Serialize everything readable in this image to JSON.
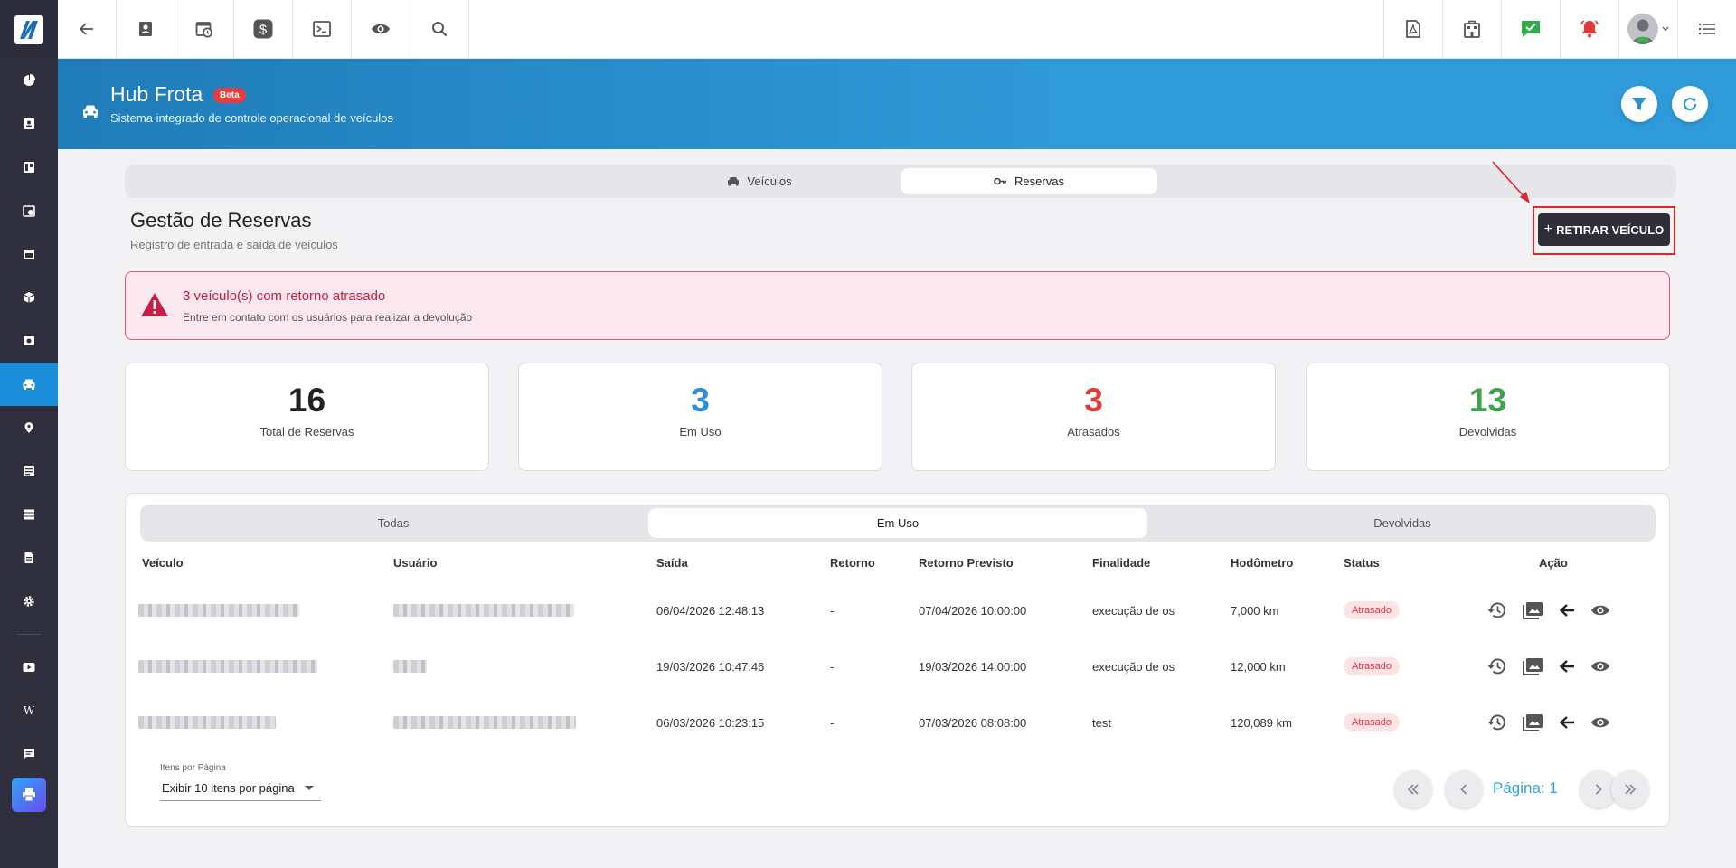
{
  "header": {
    "title": "Hub Frota",
    "badge": "Beta",
    "subtitle": "Sistema integrado de controle operacional de veículos"
  },
  "tabs": [
    {
      "label": "Veículos",
      "icon": "car-icon",
      "active": false
    },
    {
      "label": "Reservas",
      "icon": "key-icon",
      "active": true
    }
  ],
  "page": {
    "title": "Gestão de Reservas",
    "subtitle": "Registro de entrada e saída de veículos",
    "primary_button": "RETIRAR VEÍCULO",
    "primary_button_icon": "+"
  },
  "alert": {
    "title": "3 veículo(s) com retorno atrasado",
    "message": "Entre em contato com os usuários para realizar a devolução"
  },
  "stats": [
    {
      "value": "16",
      "label": "Total de Reservas",
      "color": "#222222"
    },
    {
      "value": "3",
      "label": "Em Uso",
      "color": "#2b8fe0"
    },
    {
      "value": "3",
      "label": "Atrasados",
      "color": "#e53935"
    },
    {
      "value": "13",
      "label": "Devolvidas",
      "color": "#3fa34d"
    }
  ],
  "filters": [
    "Todas",
    "Em Uso",
    "Devolvidas"
  ],
  "active_filter": "Em Uso",
  "table": {
    "columns": [
      "Veículo",
      "Usuário",
      "Saída",
      "Retorno",
      "Retorno Previsto",
      "Finalidade",
      "Hodômetro",
      "Status",
      "Ação"
    ],
    "rows": [
      {
        "saida": "06/04/2026 12:48:13",
        "retorno": "-",
        "previsto": "07/04/2026 10:00:00",
        "finalidade": "execução de os",
        "hodometro": "7,000 km",
        "status": "Atrasado"
      },
      {
        "saida": "19/03/2026 10:47:46",
        "retorno": "-",
        "previsto": "19/03/2026 14:00:00",
        "finalidade": "execução de os",
        "hodometro": "12,000 km",
        "status": "Atrasado"
      },
      {
        "saida": "06/03/2026 10:23:15",
        "retorno": "-",
        "previsto": "07/03/2026 08:08:00",
        "finalidade": "test",
        "hodometro": "120,089 km",
        "status": "Atrasado"
      }
    ]
  },
  "pagination": {
    "per_page_label": "Itens por Página",
    "per_page_value": "Exibir 10 itens por página",
    "page_text": "Página: 1"
  },
  "colors": {
    "sidebar": "#2f2f3d",
    "accent": "#1a8cd8",
    "danger": "#e0262a"
  }
}
